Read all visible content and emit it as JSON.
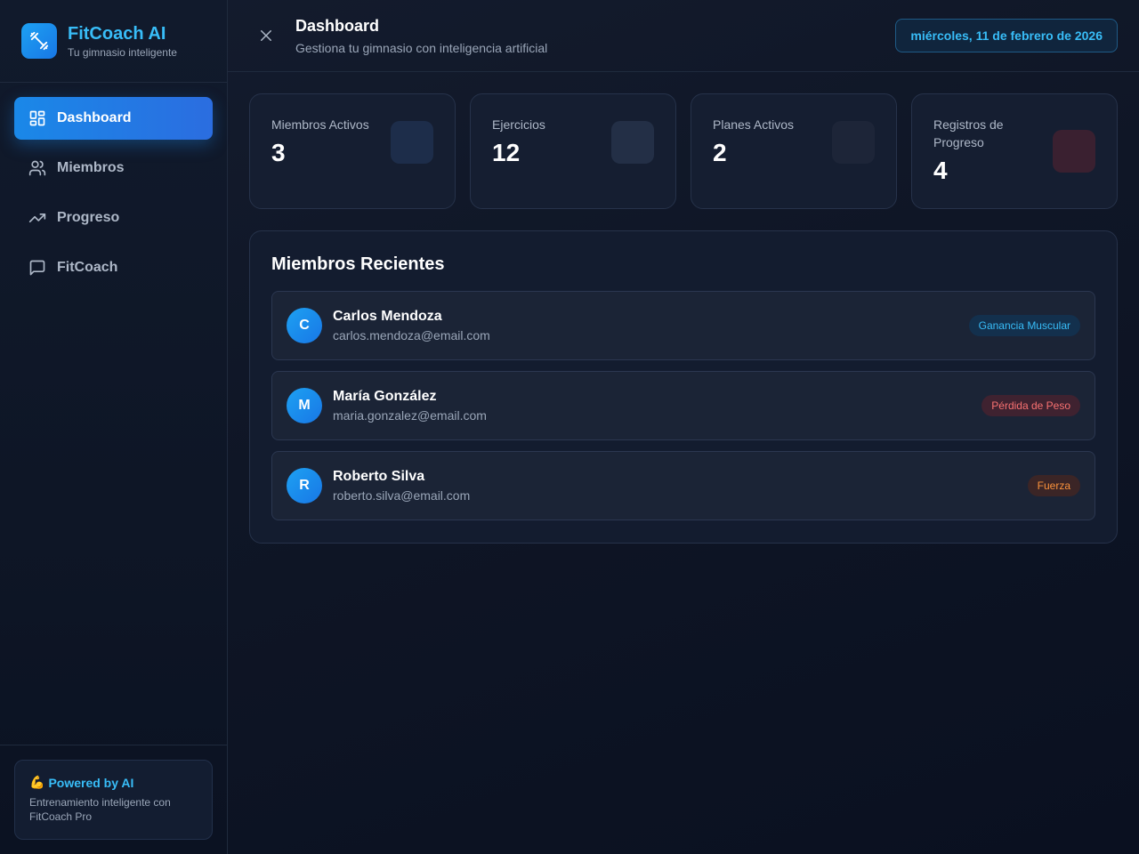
{
  "brand": {
    "title": "FitCoach AI",
    "subtitle": "Tu gimnasio inteligente",
    "logo_icon": "dumbbell-icon"
  },
  "sidebar": {
    "items": [
      {
        "label": "Dashboard",
        "icon": "dashboard-grid-icon",
        "active": true
      },
      {
        "label": "Miembros",
        "icon": "users-icon",
        "active": false
      },
      {
        "label": "Progreso",
        "icon": "trending-up-icon",
        "active": false
      },
      {
        "label": "FitCoach",
        "icon": "chat-icon",
        "active": false
      }
    ],
    "footer": {
      "emoji": "💪",
      "title": "Powered by AI",
      "description": "Entrenamiento inteligente con FitCoach Pro"
    }
  },
  "header": {
    "close_icon": "close-icon",
    "title": "Dashboard",
    "subtitle": "Gestiona tu gimnasio con inteligencia artificial",
    "date": "miércoles, 11 de febrero de 2026"
  },
  "stats": [
    {
      "label": "Miembros Activos",
      "value": "3",
      "color": "#1d2d4a"
    },
    {
      "label": "Ejercicios",
      "value": "12",
      "color": "#232f46"
    },
    {
      "label": "Planes Activos",
      "value": "2",
      "color": "#1d2538"
    },
    {
      "label": "Registros de Progreso",
      "value": "4",
      "color": "#3a2030"
    }
  ],
  "recent_members": {
    "title": "Miembros Recientes",
    "members": [
      {
        "initial": "C",
        "name": "Carlos Mendoza",
        "email": "carlos.mendoza@email.com",
        "goal": "Ganancia Muscular",
        "goal_color": "#38bdf8",
        "goal_bg": "#13304d"
      },
      {
        "initial": "M",
        "name": "María González",
        "email": "maria.gonzalez@email.com",
        "goal": "Pérdida de Peso",
        "goal_color": "#f87171",
        "goal_bg": "#3f2230"
      },
      {
        "initial": "R",
        "name": "Roberto Silva",
        "email": "roberto.silva@email.com",
        "goal": "Fuerza",
        "goal_color": "#fb923c",
        "goal_bg": "#3b2526"
      }
    ]
  },
  "colors": {
    "accent": "#38bdf8",
    "active_nav": "#1a88e8"
  }
}
